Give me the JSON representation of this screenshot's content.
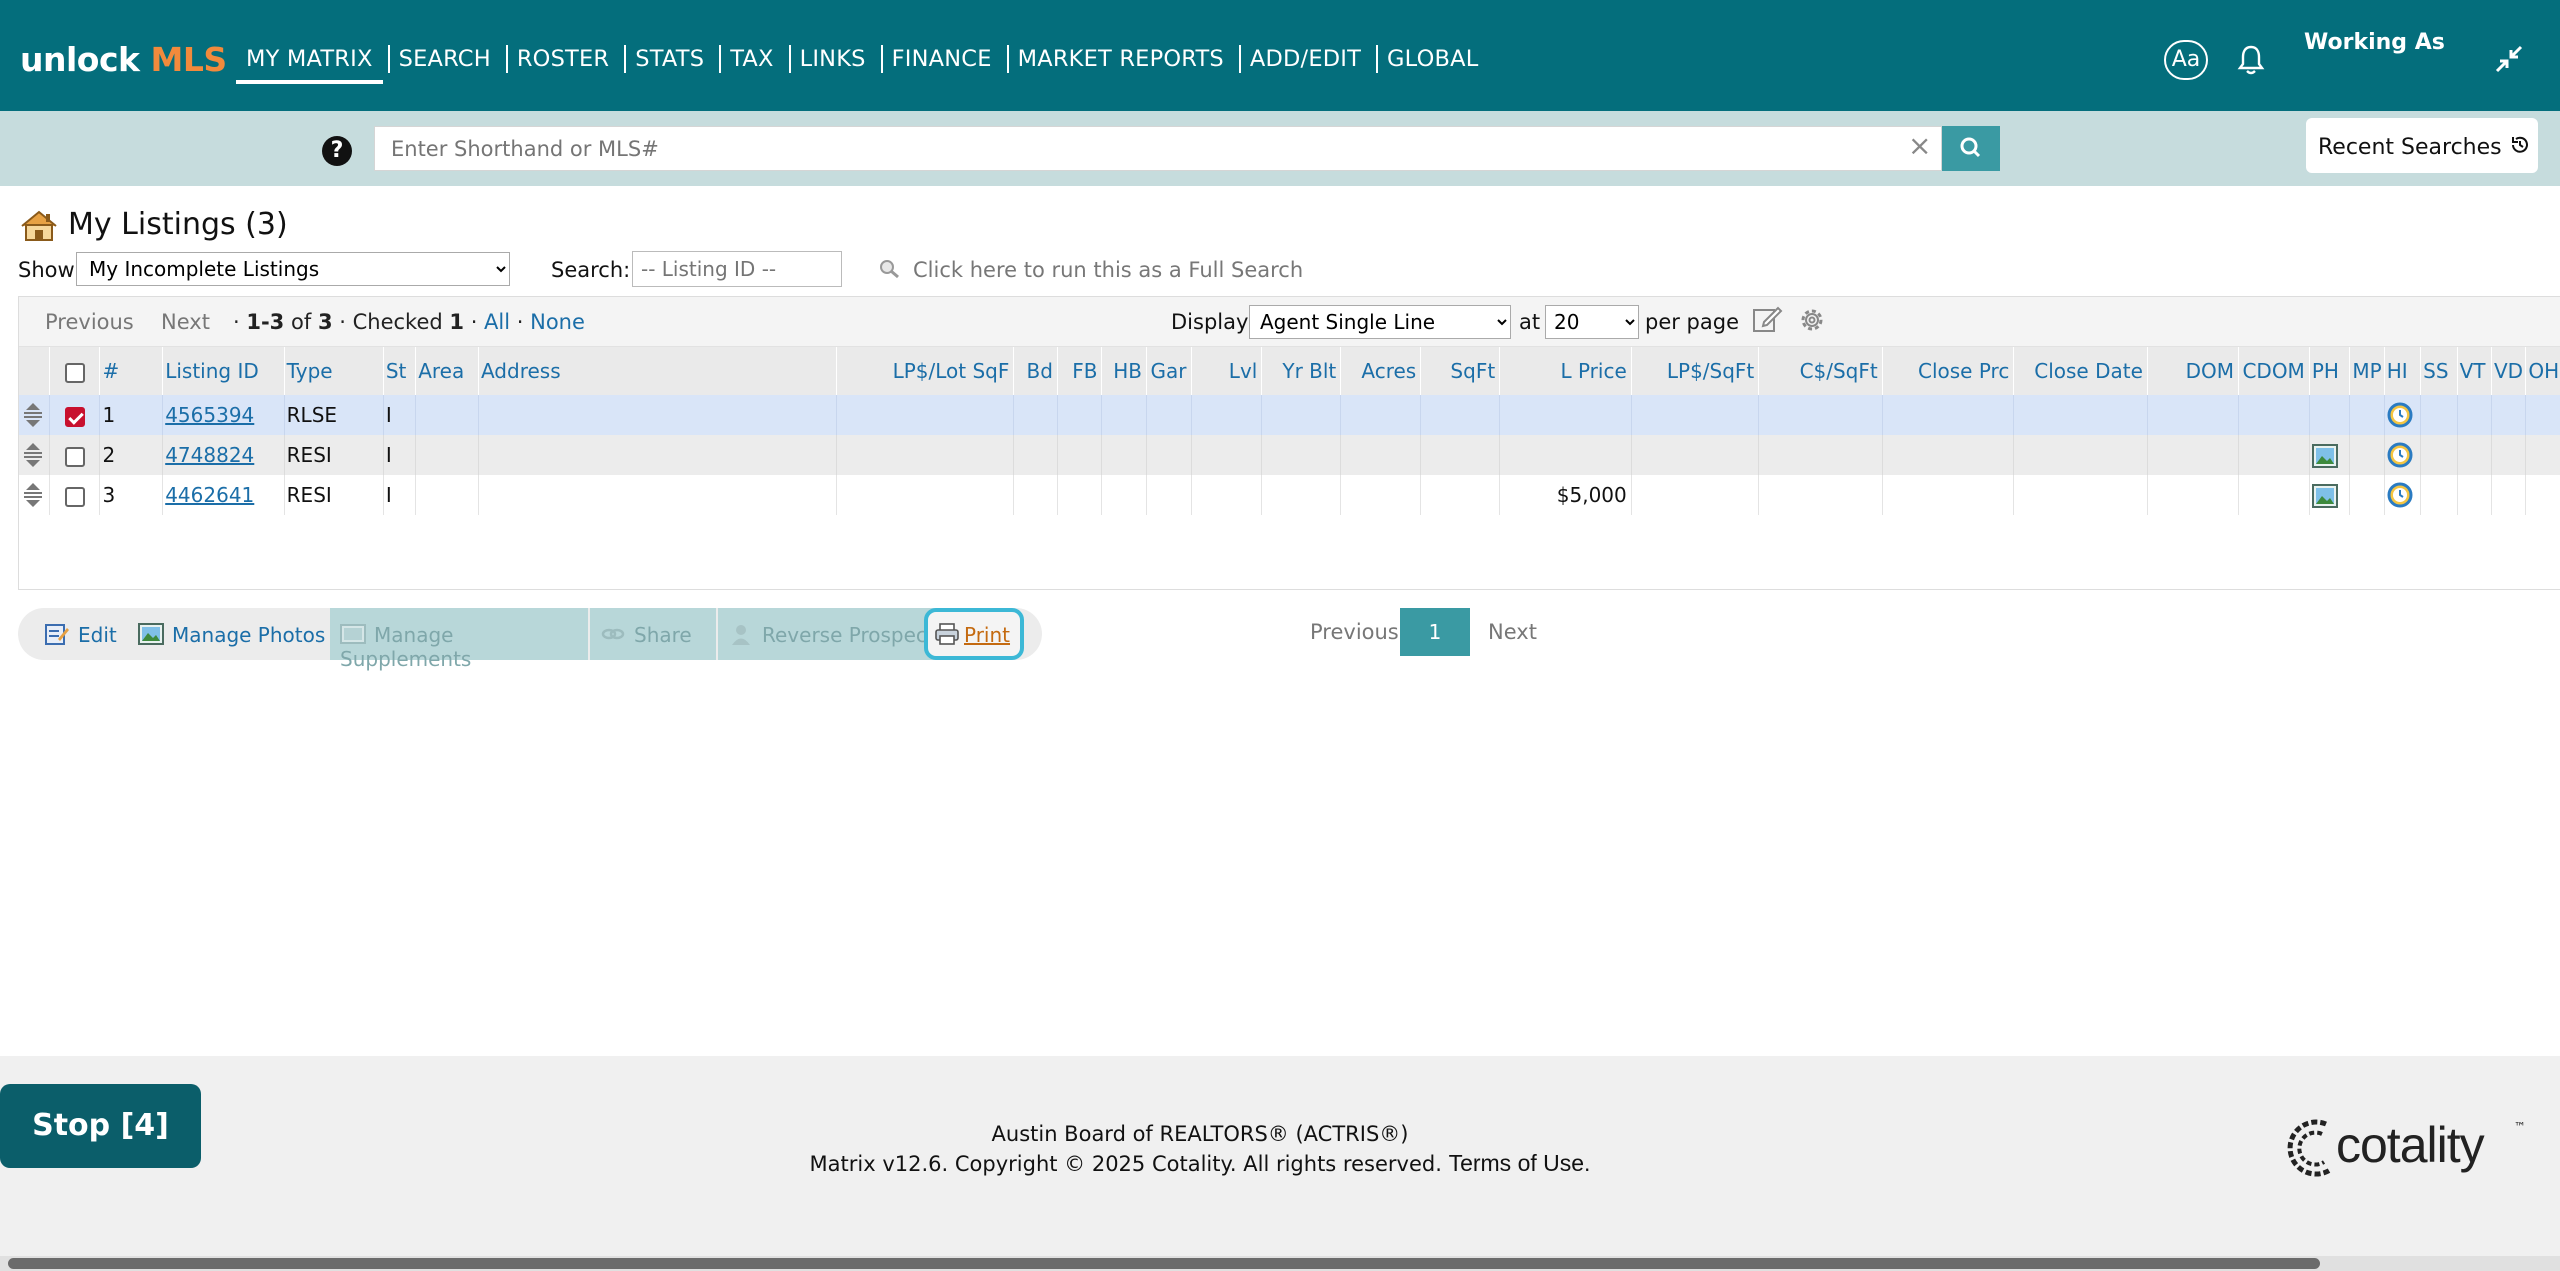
{
  "app": {
    "logo_unlock": "unlock",
    "logo_mls": "MLS"
  },
  "nav": {
    "items": [
      "MY MATRIX",
      "SEARCH",
      "ROSTER",
      "STATS",
      "TAX",
      "LINKS",
      "FINANCE",
      "MARKET REPORTS",
      "ADD/EDIT",
      "GLOBAL"
    ],
    "aa_label": "Aa",
    "working_as": "Working As"
  },
  "searchbar": {
    "placeholder": "Enter Shorthand or MLS#",
    "help": "?",
    "clear": "×",
    "recent_label": "Recent Searches"
  },
  "page": {
    "title": "My Listings (3)",
    "show_label": "Show",
    "show_value": "My Incomplete Listings",
    "search_label": "Search:",
    "listing_placeholder": "-- Listing ID --",
    "full_search": "Click here to run this as a Full Search"
  },
  "pager": {
    "previous": "Previous",
    "next": "Next",
    "range": "1-3",
    "of": "of",
    "total": "3",
    "checked_label": "Checked",
    "checked_count": "1",
    "all": "All",
    "none": "None",
    "display_label": "Display",
    "display_value": "Agent Single Line",
    "at_label": "at",
    "at_value": "20",
    "per_page": "per page"
  },
  "table": {
    "headers": [
      "#",
      "Listing ID",
      "Type",
      "St",
      "Area",
      "Address",
      "LP$/Lot SqF",
      "Bd",
      "FB",
      "HB",
      "Gar",
      "Lvl",
      "Yr Blt",
      "Acres",
      "SqFt",
      "L Price",
      "LP$/SqFt",
      "C$/SqFt",
      "Close Prc",
      "Close Date",
      "DOM",
      "CDOM",
      "PH",
      "MP",
      "HI",
      "SS",
      "VT",
      "VD",
      "OH"
    ],
    "rows": [
      {
        "num": "1",
        "listing_id": "4565394",
        "type": "RLSE",
        "status": "I",
        "price": "",
        "checked": true,
        "has_photo": false
      },
      {
        "num": "2",
        "listing_id": "4748824",
        "type": "RESI",
        "status": "I",
        "price": "",
        "checked": false,
        "has_photo": true
      },
      {
        "num": "3",
        "listing_id": "4462641",
        "type": "RESI",
        "status": "I",
        "price": "$5,000",
        "checked": false,
        "has_photo": true
      }
    ]
  },
  "actions": {
    "edit": "Edit",
    "manage_photos": "Manage Photos",
    "manage_supplements": "Manage Supplements",
    "share": "Share",
    "reverse_prospect": "Reverse Prospect",
    "print": "Print"
  },
  "bottom_pager": {
    "previous": "Previous",
    "page": "1",
    "next": "Next"
  },
  "footer": {
    "line1": "Austin Board of REALTORS® (ACTRIS®)",
    "line2": "Matrix v12.6. Copyright © 2025 Cotality. All rights reserved.",
    "terms": "Terms of Use.",
    "brand": "cotality",
    "tm": "™"
  },
  "stop_button": "Stop [4]",
  "colors": {
    "topbar": "#046e7c",
    "accent_orange": "#f28a3c",
    "link_blue": "#1b6ea8",
    "teal_button": "#3a9aa3",
    "selected_row": "#d9e5f8",
    "checkbox_red": "#c8102e"
  }
}
